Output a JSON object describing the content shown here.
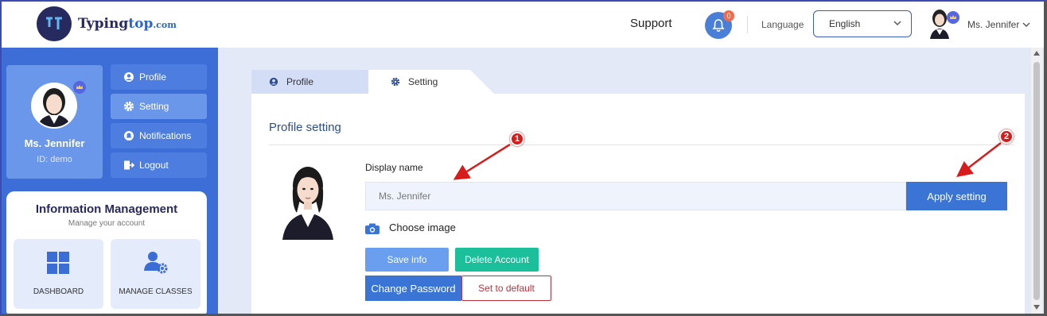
{
  "header": {
    "logo_text": "Typing",
    "logo_text_accent": "top",
    "logo_domain": ".com",
    "support_label": "Support",
    "notification_count": "0",
    "language_label": "Language",
    "language_value": "English",
    "user_name": "Ms. Jennifer"
  },
  "sidebar": {
    "profile": {
      "name": "Ms. Jennifer",
      "id": "ID: demo"
    },
    "menu": [
      {
        "label": "Profile",
        "icon": "user-circle-icon"
      },
      {
        "label": "Setting",
        "icon": "gear-icon"
      },
      {
        "label": "Notifications",
        "icon": "bell-icon"
      },
      {
        "label": "Logout",
        "icon": "logout-icon"
      }
    ],
    "info": {
      "title": "Information Management",
      "subtitle": "Manage your account",
      "tiles": [
        {
          "label": "DASHBOARD",
          "icon": "dashboard-grid-icon"
        },
        {
          "label": "MANAGE CLASSES",
          "icon": "user-gear-icon"
        }
      ]
    }
  },
  "tabs": [
    {
      "label": "Profile",
      "icon": "user-circle-icon"
    },
    {
      "label": "Setting",
      "icon": "gear-icon"
    }
  ],
  "panel": {
    "title": "Profile setting",
    "display_name_label": "Display name",
    "display_name_value": "Ms. Jennifer",
    "apply_label": "Apply setting",
    "choose_image_label": "Choose image",
    "save_label": "Save info",
    "delete_label": "Delete Account",
    "change_password_label": "Change Password",
    "default_label": "Set to default"
  },
  "annotations": [
    {
      "number": "1"
    },
    {
      "number": "2"
    }
  ],
  "colors": {
    "brand_dark": "#262a5e",
    "sidebar": "#3d6dd6",
    "primary": "#3a74d4",
    "success": "#1bbf9a",
    "danger": "#c0303a",
    "annotation": "#d81c1c"
  }
}
